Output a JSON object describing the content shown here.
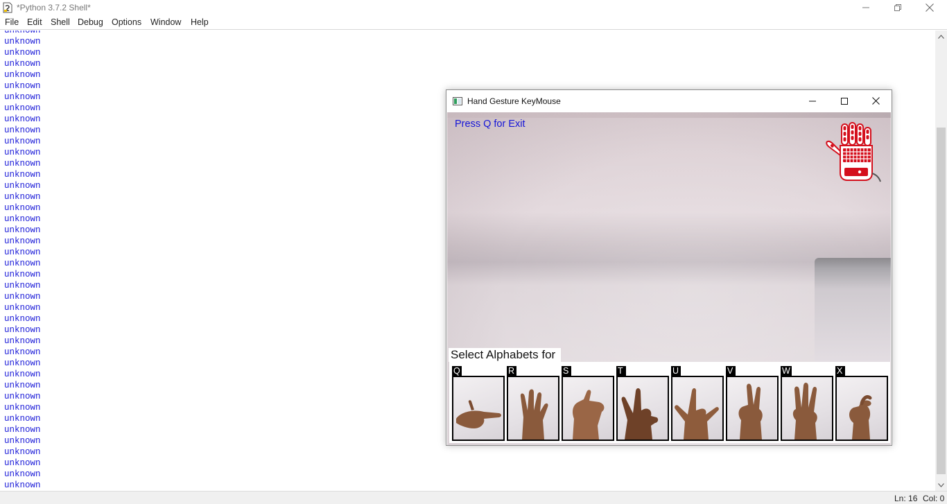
{
  "shell": {
    "title": "*Python 3.7.2 Shell*",
    "menu": [
      "File",
      "Edit",
      "Shell",
      "Debug",
      "Options",
      "Window",
      "Help"
    ],
    "output_lines": [
      "unknown",
      "unknown",
      "unknown",
      "unknown",
      "unknown",
      "unknown",
      "unknown",
      "unknown",
      "unknown",
      "unknown",
      "unknown",
      "unknown",
      "unknown",
      "unknown",
      "unknown",
      "unknown",
      "unknown",
      "unknown",
      "unknown",
      "unknown",
      "unknown",
      "unknown",
      "unknown",
      "unknown",
      "unknown",
      "unknown",
      "unknown",
      "unknown",
      "unknown",
      "unknown",
      "unknown",
      "unknown",
      "unknown",
      "unknown",
      "unknown",
      "unknown",
      "unknown",
      "unknown",
      "unknown",
      "unknown",
      "unknown",
      "unknown",
      "unknown",
      "unknown"
    ],
    "status": {
      "ln": "Ln: 16",
      "col": "Col: 0"
    },
    "colors": {
      "output": "#1a1ad8"
    }
  },
  "gesture_window": {
    "title": "Hand Gesture KeyMouse",
    "exit_hint": "Press Q for Exit",
    "select_label": "Select Alphabets for",
    "letters": [
      "Q",
      "R",
      "S",
      "T",
      "U",
      "V",
      "W",
      "X"
    ],
    "colors": {
      "exit_hint": "#1515d8",
      "logo": "#d40f1c"
    }
  }
}
